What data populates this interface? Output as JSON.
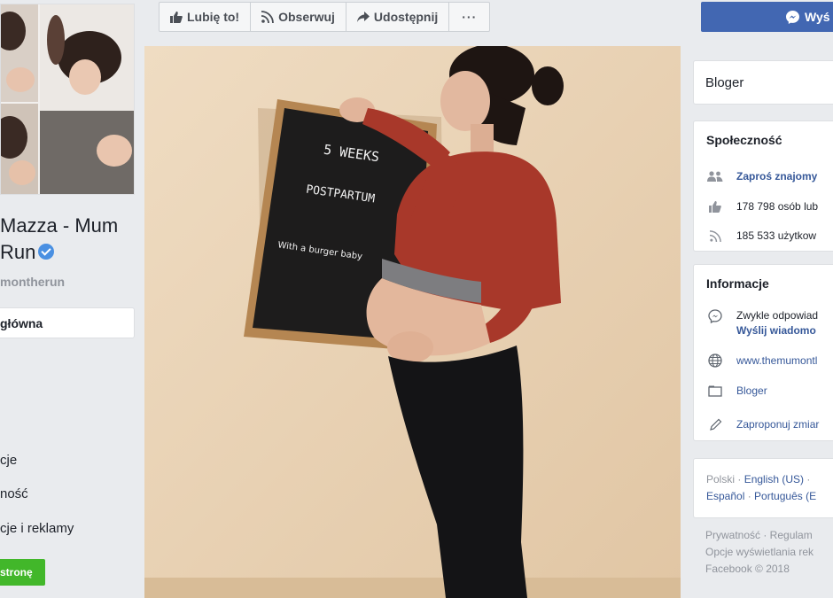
{
  "left": {
    "name_line1": "Mazza - Mum",
    "name_line2": "Run",
    "handle": "montherun",
    "nav_main": "główna",
    "nav_items": [
      "cje",
      "ność",
      "cje i reklamy"
    ],
    "create_button": "stronę"
  },
  "actionbar": {
    "like": "Lubię to!",
    "follow": "Obserwuj",
    "share": "Udostępnij",
    "more": "···",
    "message": "Wyś"
  },
  "photo": {
    "board_line1": "5  WEEKS",
    "board_line2": "POSTPARTUM",
    "board_line3": "With a burger baby"
  },
  "sidebar": {
    "category": "Bloger",
    "community": {
      "title": "Społeczność",
      "invite": "Zaproś znajomy",
      "likes": "178 798 osób lub",
      "follows": "185 533 użytkow"
    },
    "info": {
      "title": "Informacje",
      "response_line1": "Zwykle odpowiad",
      "response_line2": "Wyślij wiadomo",
      "website": "www.themumontl",
      "category": "Bloger",
      "suggest": "Zaproponuj zmiar"
    },
    "languages": {
      "current": "Polski",
      "sep": " · ",
      "lang2": "English (US)",
      "sep2": " ·",
      "lang3": "Español",
      "lang4": "Português (E"
    },
    "footer": {
      "line1": "Prywatność · Regulam",
      "line2": "Opcje wyświetlania rek",
      "line3": "Facebook © 2018"
    }
  },
  "colors": {
    "fb_blue": "#4267b2",
    "link": "#365899",
    "green": "#42b72a",
    "verified": "#4a90e2",
    "wall": "#e8d4b8",
    "sweater": "#a8382a"
  },
  "icons": [
    "thumbs-up-icon",
    "rss-icon",
    "share-arrow-icon",
    "messenger-icon",
    "friends-icon",
    "like-icon",
    "rss-follow-icon",
    "messenger-bubble-icon",
    "globe-icon",
    "category-icon",
    "pencil-icon",
    "verified-badge-icon"
  ]
}
